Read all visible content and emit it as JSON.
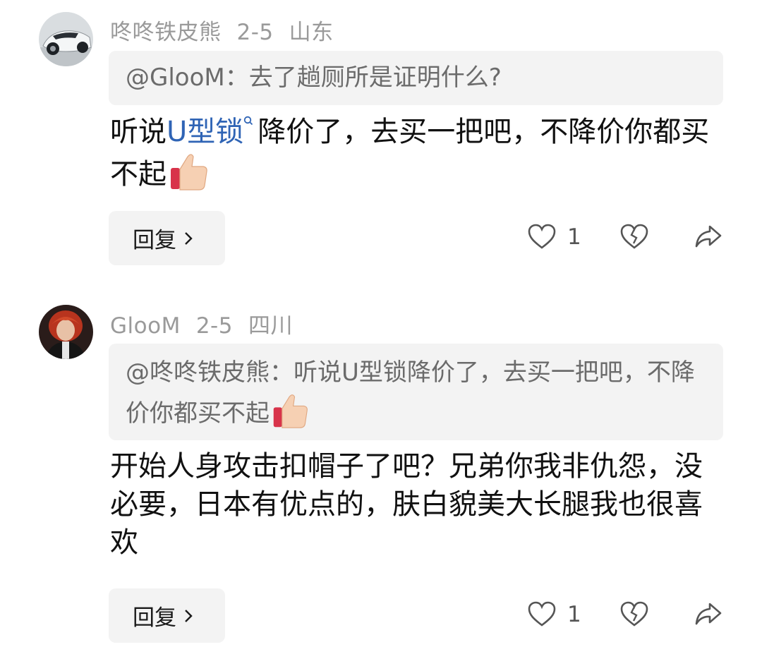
{
  "comments": [
    {
      "username": "咚咚铁皮熊",
      "date": "2-5",
      "location": "山东",
      "quote": "@GlooM：去了趟厕所是证明什么?",
      "text_before_link": "听说",
      "link_text": "U型锁",
      "text_after_link": "降价了，去买一把吧，不降价你都买不起",
      "reply_label": "回复",
      "like_count": "1",
      "avatar_icon": "car-avatar",
      "emoji_icon": "thumbs-up-emoji"
    },
    {
      "username": "GlooM",
      "date": "2-5",
      "location": "四川",
      "quote": "@咚咚铁皮熊：听说U型锁降价了，去买一把吧，不降价你都买不起",
      "text": "开始人身攻击扣帽子了吧？兄弟你我非仇怨，没必要，日本有优点的，肤白貌美大长腿我也很喜欢",
      "reply_label": "回复",
      "like_count": "1",
      "avatar_icon": "person-avatar",
      "emoji_icon": "thumbs-up-emoji"
    }
  ],
  "icons": {
    "like": "heart-outline-icon",
    "dislike": "broken-heart-icon",
    "share": "share-arrow-icon",
    "chevron": "chevron-right-icon"
  },
  "colors": {
    "link": "#2f64b5",
    "meta": "#9a9a9a",
    "bubble": "#f3f3f3"
  }
}
